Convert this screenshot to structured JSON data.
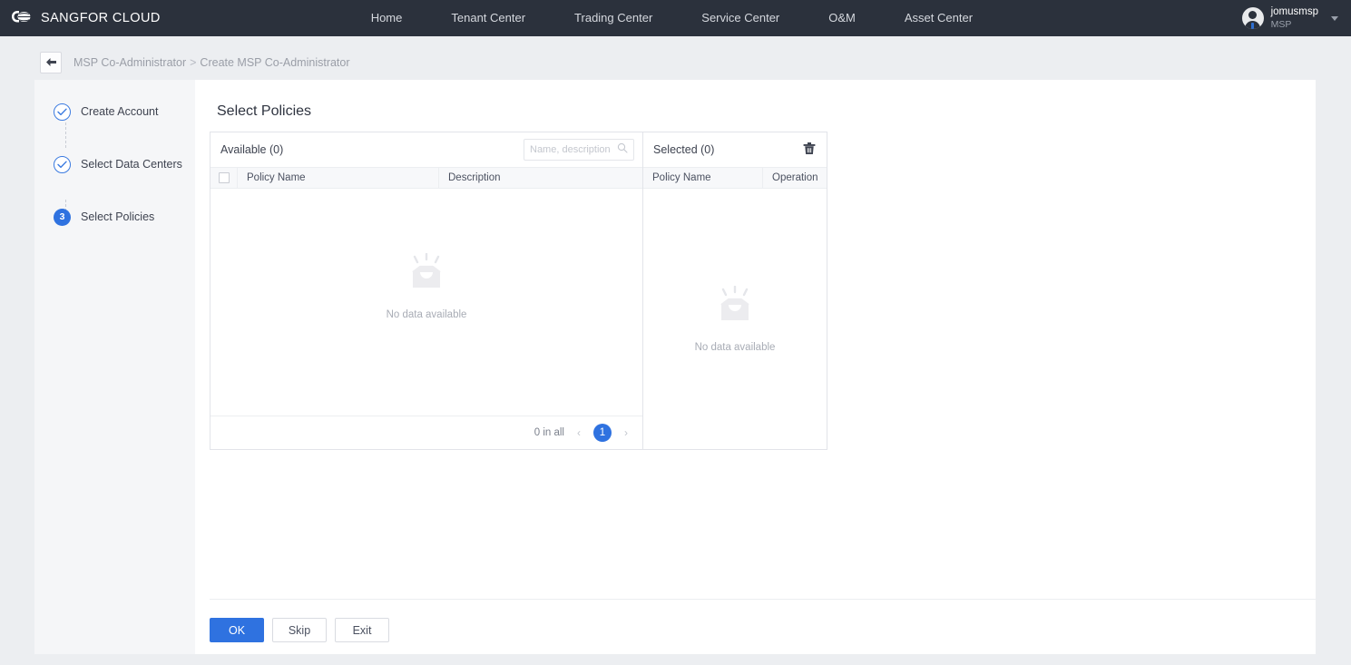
{
  "topnav": {
    "brand": "SANGFOR CLOUD",
    "logo_icon": "cloud-globe-logo",
    "links": [
      {
        "label": "Home"
      },
      {
        "label": "Tenant Center"
      },
      {
        "label": "Trading Center"
      },
      {
        "label": "Service Center"
      },
      {
        "label": "O&M"
      },
      {
        "label": "Asset Center"
      }
    ],
    "user": {
      "name": "jomusmsp",
      "role": "MSP",
      "avatar_icon": "user-avatar-icon",
      "caret_icon": "chevron-down-icon"
    }
  },
  "breadcrumb": {
    "back_icon": "arrow-left-icon",
    "parent": "MSP Co-Administrator",
    "separator": ">",
    "current": "Create MSP Co-Administrator"
  },
  "steps": [
    {
      "label": "Create Account",
      "state": "done",
      "mark": "✓"
    },
    {
      "label": "Select Data Centers",
      "state": "done",
      "mark": "✓"
    },
    {
      "label": "Select Policies",
      "state": "current",
      "mark": "3"
    }
  ],
  "main": {
    "title": "Select Policies"
  },
  "transfer": {
    "available": {
      "title": "Available (0)",
      "search_placeholder": "Name, description",
      "search_value": "",
      "search_icon": "search-icon",
      "columns": [
        "Policy Name",
        "Description"
      ],
      "rows": [],
      "empty_text": "No data available",
      "empty_icon": "empty-inbox-icon",
      "pagination": {
        "total_text": "0 in all",
        "prev_icon": "chevron-left-icon",
        "next_icon": "chevron-right-icon",
        "current_page": "1"
      }
    },
    "selected": {
      "title": "Selected (0)",
      "clear_icon": "trash-icon",
      "columns": [
        "Policy Name",
        "Operation"
      ],
      "rows": [],
      "empty_text": "No data available",
      "empty_icon": "empty-inbox-icon"
    }
  },
  "actions": {
    "ok": "OK",
    "skip": "Skip",
    "exit": "Exit"
  },
  "colors": {
    "accent": "#2f72e0",
    "navbar": "#2b313c",
    "page_bg": "#eceef1",
    "rail_bg": "#f5f6f8"
  }
}
